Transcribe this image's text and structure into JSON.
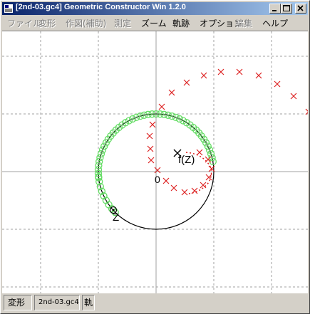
{
  "window": {
    "title": "[2nd-03.gc4] Geometric Constructor Win 1.2.0"
  },
  "menubar": {
    "items": [
      {
        "label": "ファイル",
        "enabled": false
      },
      {
        "label": "変形",
        "enabled": false
      },
      {
        "label": "作図(補助)",
        "enabled": false
      },
      {
        "label": "測定",
        "enabled": false
      },
      {
        "label": "ズーム",
        "enabled": true
      },
      {
        "label": "軌跡",
        "enabled": true
      },
      {
        "label": "オプション",
        "enabled": true
      },
      {
        "label": "編集",
        "enabled": false
      },
      {
        "label": "ヘルプ",
        "enabled": true
      }
    ]
  },
  "canvas": {
    "origin_label": "0",
    "point_z_label": "Z",
    "point_fz_label": "f(Z)",
    "colors": {
      "grid": "#a0a0a0",
      "axes": "#a0a0a0",
      "circle": "#000000",
      "trace_z": "#66dd66",
      "trace_fz": "#dd2222"
    }
  },
  "statusbar": {
    "mode": "変形",
    "file": "2nd-03.gc4",
    "trace": "軌"
  }
}
